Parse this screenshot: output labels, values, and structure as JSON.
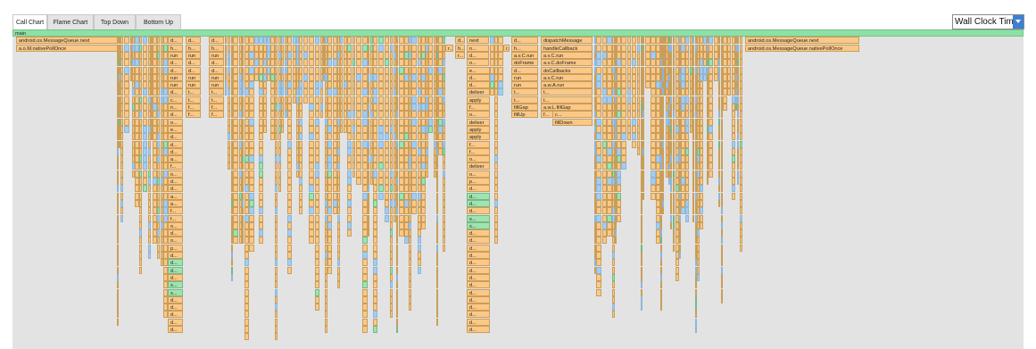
{
  "tabs": [
    {
      "label": "Call Chart",
      "active": true
    },
    {
      "label": "Flame Chart",
      "active": false
    },
    {
      "label": "Top Down",
      "active": false
    },
    {
      "label": "Bottom Up",
      "active": false
    }
  ],
  "clock_selector": {
    "value": "Wall Clock Time"
  },
  "colors": {
    "main": "#8fe0a4",
    "frame": "#fcc887",
    "blue": "#a4cdee",
    "green": "#9fe3ae",
    "background": "#e3e3e3"
  },
  "chart": {
    "root": "main",
    "frames": [
      {
        "row": 1,
        "col": "a",
        "label": "android.os.MessageQueue.next"
      },
      {
        "row": 2,
        "col": "a",
        "label": "a.o.M.nativePollOnce"
      },
      {
        "row": 1,
        "col": "r",
        "label": "android.os.MessageQueue.next"
      },
      {
        "row": 2,
        "col": "r",
        "label": "android.os.MessageQueue.nativePollOnce"
      },
      {
        "row": 1,
        "col": "b",
        "label": "d..."
      },
      {
        "row": 2,
        "col": "b",
        "label": "h..."
      },
      {
        "row": 3,
        "col": "b",
        "label": "run"
      },
      {
        "row": 4,
        "col": "b",
        "label": "d..."
      },
      {
        "row": 5,
        "col": "b",
        "label": "d..."
      },
      {
        "row": 6,
        "col": "b",
        "label": "run"
      },
      {
        "row": 7,
        "col": "b",
        "label": "run"
      },
      {
        "row": 8,
        "col": "b",
        "label": "d..."
      },
      {
        "row": 9,
        "col": "b",
        "label": "c..."
      },
      {
        "row": 10,
        "col": "b",
        "label": "n..."
      },
      {
        "row": 11,
        "col": "b",
        "label": "d..."
      },
      {
        "row": 12,
        "col": "b",
        "label": "o..."
      },
      {
        "row": 13,
        "col": "b",
        "label": "e..."
      },
      {
        "row": 14,
        "col": "b",
        "label": "d..."
      },
      {
        "row": 15,
        "col": "b",
        "label": "d..."
      },
      {
        "row": 16,
        "col": "b",
        "label": "d..."
      },
      {
        "row": 17,
        "col": "b",
        "label": "a..."
      },
      {
        "row": 18,
        "col": "b",
        "label": "f..."
      },
      {
        "row": 19,
        "col": "b",
        "label": "o..."
      },
      {
        "row": 20,
        "col": "b",
        "label": "d..."
      },
      {
        "row": 21,
        "col": "b",
        "label": "d..."
      },
      {
        "row": 22,
        "col": "b",
        "label": "a..."
      },
      {
        "row": 23,
        "col": "b",
        "label": "a..."
      },
      {
        "row": 24,
        "col": "b",
        "label": "f..."
      },
      {
        "row": 25,
        "col": "b",
        "label": "f..."
      },
      {
        "row": 26,
        "col": "b",
        "label": "o..."
      },
      {
        "row": 27,
        "col": "b",
        "label": "d..."
      },
      {
        "row": 28,
        "col": "b",
        "label": "o..."
      },
      {
        "row": 29,
        "col": "b",
        "label": "p..."
      },
      {
        "row": 30,
        "col": "b",
        "label": "d..."
      },
      {
        "row": 31,
        "col": "b",
        "label": "d...",
        "color": "g"
      },
      {
        "row": 32,
        "col": "b",
        "label": "d...",
        "color": "g"
      },
      {
        "row": 33,
        "col": "b",
        "label": "d..."
      },
      {
        "row": 34,
        "col": "b",
        "label": "s...",
        "color": "g"
      },
      {
        "row": 35,
        "col": "b",
        "label": "s...",
        "color": "g"
      },
      {
        "row": 36,
        "col": "b",
        "label": "d..."
      },
      {
        "row": 37,
        "col": "b",
        "label": "d..."
      },
      {
        "row": 38,
        "col": "b",
        "label": "d..."
      },
      {
        "row": 39,
        "col": "b",
        "label": "d..."
      },
      {
        "row": 40,
        "col": "b",
        "label": "d..."
      },
      {
        "row": 1,
        "col": "c",
        "label": "d..."
      },
      {
        "row": 2,
        "col": "c",
        "label": "h..."
      },
      {
        "row": 3,
        "col": "c",
        "label": "run"
      },
      {
        "row": 4,
        "col": "c",
        "label": "d..."
      },
      {
        "row": 5,
        "col": "c",
        "label": "d..."
      },
      {
        "row": 6,
        "col": "c",
        "label": "run"
      },
      {
        "row": 7,
        "col": "c",
        "label": "run"
      },
      {
        "row": 8,
        "col": "c",
        "label": "t..."
      },
      {
        "row": 9,
        "col": "c",
        "label": "t..."
      },
      {
        "row": 10,
        "col": "c",
        "label": "f..."
      },
      {
        "row": 11,
        "col": "c",
        "label": "f..."
      },
      {
        "row": 1,
        "col": "d",
        "label": "d..."
      },
      {
        "row": 2,
        "col": "d",
        "label": "h..."
      },
      {
        "row": 3,
        "col": "d",
        "label": "run"
      },
      {
        "row": 4,
        "col": "d",
        "label": "d..."
      },
      {
        "row": 5,
        "col": "d",
        "label": "d..."
      },
      {
        "row": 6,
        "col": "d",
        "label": "run"
      },
      {
        "row": 7,
        "col": "d",
        "label": "run"
      },
      {
        "row": 8,
        "col": "d",
        "label": "t..."
      },
      {
        "row": 9,
        "col": "d",
        "label": "t..."
      },
      {
        "row": 10,
        "col": "d",
        "label": "f..."
      },
      {
        "row": 11,
        "col": "d",
        "label": "f..."
      },
      {
        "row": 2,
        "col": "e",
        "label": "r..."
      },
      {
        "row": 1,
        "col": "f",
        "label": "d..."
      },
      {
        "row": 2,
        "col": "f",
        "label": "h..."
      },
      {
        "row": 3,
        "col": "f",
        "label": "r..."
      },
      {
        "row": 1,
        "col": "g",
        "label": "next"
      },
      {
        "row": 2,
        "col": "g",
        "label": "n..."
      },
      {
        "row": 3,
        "col": "g",
        "label": "d..."
      },
      {
        "row": 4,
        "col": "g",
        "label": "o..."
      },
      {
        "row": 5,
        "col": "h",
        "label": "e..."
      },
      {
        "row": 6,
        "col": "h",
        "label": "d..."
      },
      {
        "row": 7,
        "col": "h",
        "label": "d..."
      },
      {
        "row": 8,
        "col": "h",
        "label": "deliver"
      },
      {
        "row": 9,
        "col": "h",
        "label": "apply"
      },
      {
        "row": 10,
        "col": "h",
        "label": "f..."
      },
      {
        "row": 11,
        "col": "h",
        "label": "o..."
      },
      {
        "row": 12,
        "col": "h",
        "label": "deliver"
      },
      {
        "row": 13,
        "col": "h",
        "label": "apply"
      },
      {
        "row": 14,
        "col": "h",
        "label": "apply"
      },
      {
        "row": 15,
        "col": "h",
        "label": "f..."
      },
      {
        "row": 16,
        "col": "h",
        "label": "f..."
      },
      {
        "row": 17,
        "col": "h",
        "label": "o..."
      },
      {
        "row": 18,
        "col": "h",
        "label": "deliver"
      },
      {
        "row": 19,
        "col": "h",
        "label": "o..."
      },
      {
        "row": 20,
        "col": "h",
        "label": "p..."
      },
      {
        "row": 21,
        "col": "h",
        "label": "d..."
      },
      {
        "row": 22,
        "col": "h",
        "label": "d...",
        "color": "g"
      },
      {
        "row": 23,
        "col": "h",
        "label": "d...",
        "color": "g"
      },
      {
        "row": 24,
        "col": "h",
        "label": "d..."
      },
      {
        "row": 25,
        "col": "h",
        "label": "s...",
        "color": "g"
      },
      {
        "row": 26,
        "col": "h",
        "label": "s...",
        "color": "g"
      },
      {
        "row": 27,
        "col": "h",
        "label": "d..."
      },
      {
        "row": 28,
        "col": "h",
        "label": "d..."
      },
      {
        "row": 29,
        "col": "h",
        "label": "d..."
      },
      {
        "row": 30,
        "col": "h",
        "label": "d..."
      },
      {
        "row": 31,
        "col": "h",
        "label": "d..."
      },
      {
        "row": 32,
        "col": "h",
        "label": "d..."
      },
      {
        "row": 33,
        "col": "h",
        "label": "d..."
      },
      {
        "row": 34,
        "col": "h",
        "label": "d..."
      },
      {
        "row": 35,
        "col": "h",
        "label": "d..."
      },
      {
        "row": 36,
        "col": "h",
        "label": "d..."
      },
      {
        "row": 37,
        "col": "h",
        "label": "d..."
      },
      {
        "row": 38,
        "col": "h",
        "label": "d..."
      },
      {
        "row": 39,
        "col": "h",
        "label": "d..."
      },
      {
        "row": 40,
        "col": "h",
        "label": "d..."
      },
      {
        "row": 2,
        "col": "i",
        "label": "r..."
      },
      {
        "row": 1,
        "col": "j",
        "label": "d..."
      },
      {
        "row": 2,
        "col": "j",
        "label": "h..."
      },
      {
        "row": 3,
        "col": "j",
        "label": "a.v.C.run"
      },
      {
        "row": 4,
        "col": "j",
        "label": "doFrame"
      },
      {
        "row": 5,
        "col": "j",
        "label": "d..."
      },
      {
        "row": 6,
        "col": "j",
        "label": "run"
      },
      {
        "row": 7,
        "col": "j",
        "label": "run"
      },
      {
        "row": 8,
        "col": "j",
        "label": "t..."
      },
      {
        "row": 9,
        "col": "j",
        "label": "t..."
      },
      {
        "row": 10,
        "col": "j",
        "label": "fillGap"
      },
      {
        "row": 11,
        "col": "j",
        "label": "fillUp"
      },
      {
        "row": 1,
        "col": "k",
        "label": "dispatchMessage"
      },
      {
        "row": 2,
        "col": "k",
        "label": "handleCallback"
      },
      {
        "row": 3,
        "col": "k",
        "label": "a.v.C.run"
      },
      {
        "row": 4,
        "col": "k",
        "label": "a.v.C.doFrame"
      },
      {
        "row": 5,
        "col": "k",
        "label": "doCallbacks"
      },
      {
        "row": 6,
        "col": "k",
        "label": "a.v.C.run"
      },
      {
        "row": 7,
        "col": "k",
        "label": "a.w.A.run"
      },
      {
        "row": 8,
        "col": "k",
        "label": "t..."
      },
      {
        "row": 9,
        "col": "k",
        "label": "t..."
      },
      {
        "row": 10,
        "col": "k",
        "label": "a.w.L.fillGap"
      },
      {
        "row": 11,
        "col": "k",
        "label": "f..."
      },
      {
        "row": 11,
        "col": "k2",
        "label": "c..."
      },
      {
        "row": 12,
        "col": "k2",
        "label": "fillDown"
      }
    ]
  }
}
